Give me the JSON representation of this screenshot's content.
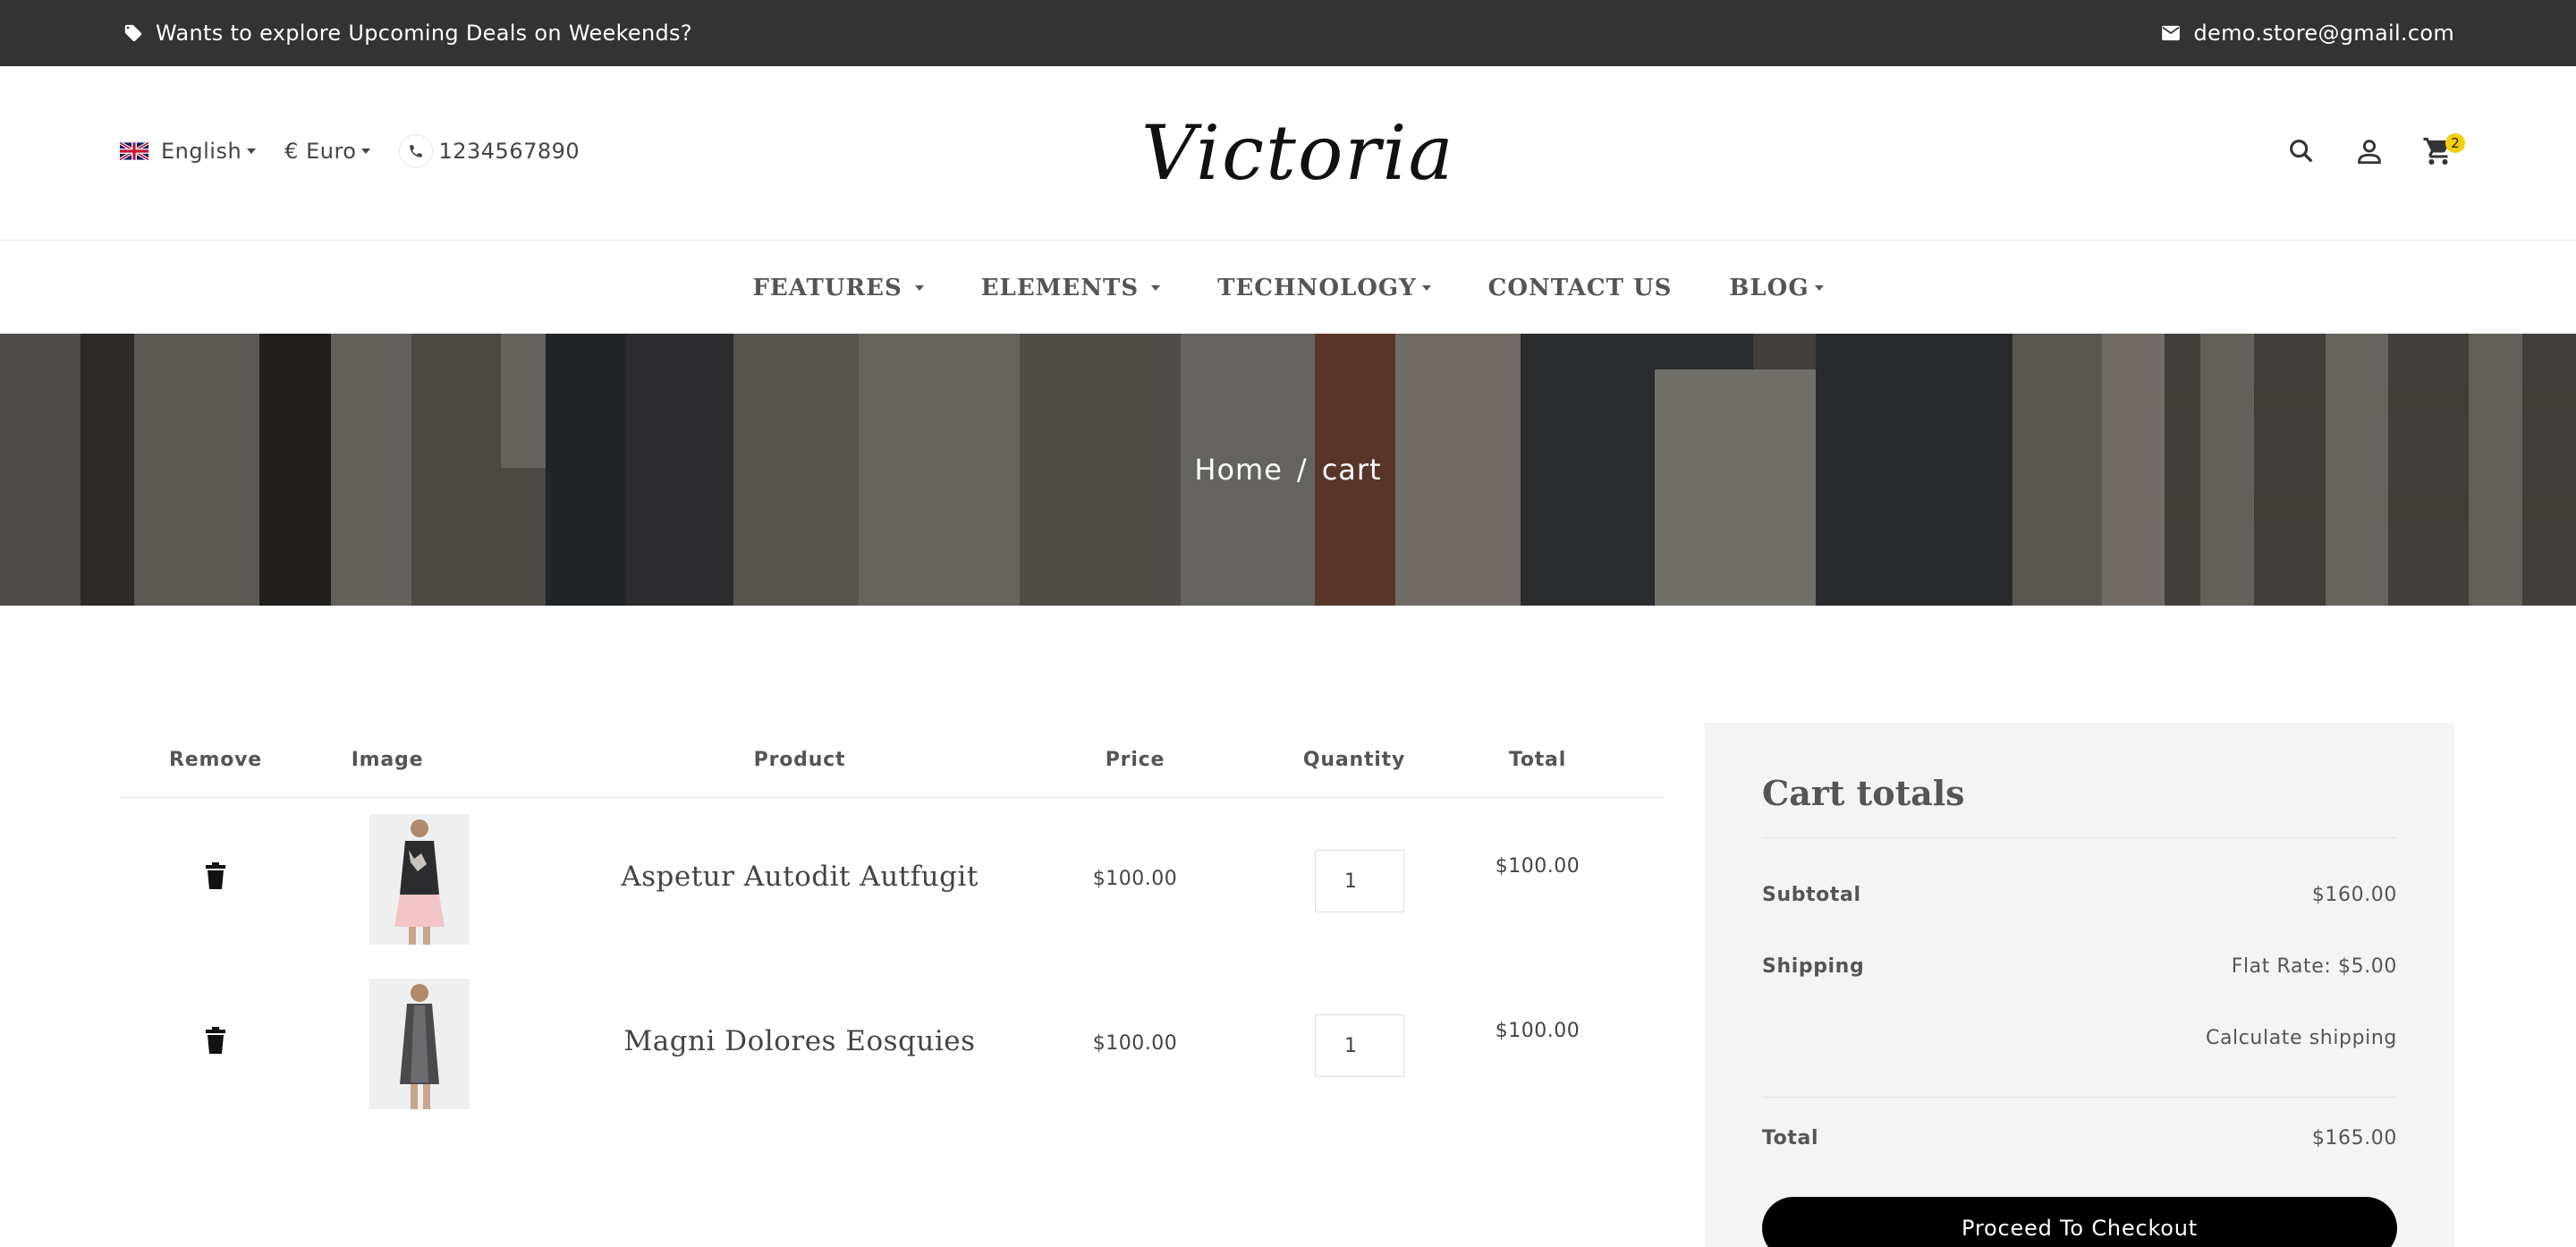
{
  "topbar": {
    "promo_text": "Wants to explore Upcoming Deals on Weekends?",
    "email": "demo.store@gmail.com",
    "icons": {
      "promo": "tag-icon",
      "email": "mail-icon"
    }
  },
  "header": {
    "language": "English",
    "currency": "€ Euro",
    "phone": "1234567890",
    "logo": "Victoria",
    "cart_count": "2",
    "icons": {
      "search": "search-icon",
      "account": "user-icon",
      "cart": "cart-icon",
      "phone": "phone-icon",
      "flag": "uk-flag-icon"
    }
  },
  "nav": {
    "items": [
      "FEATURES",
      "ELEMENTS",
      "TECHNOLOGY",
      "CONTACT US",
      "BLOG"
    ]
  },
  "breadcrumb": {
    "home": "Home",
    "separator": "/",
    "current": "cart"
  },
  "cart_table": {
    "headers": [
      "Remove",
      "Image",
      "Product",
      "Price",
      "Quantity",
      "Total"
    ],
    "rows": [
      {
        "product": "Aspetur Autodit Autfugit",
        "price": "$100.00",
        "quantity": "1",
        "total": "$100.00"
      },
      {
        "product": "Magni Dolores Eosquies",
        "price": "$100.00",
        "quantity": "1",
        "total": "$100.00"
      }
    ]
  },
  "cart_totals": {
    "title": "Cart totals",
    "subtotal_label": "Subtotal",
    "subtotal_value": "$160.00",
    "shipping_label": "Shipping",
    "shipping_value": "Flat Rate: $5.00",
    "calculate_shipping": "Calculate shipping",
    "total_label": "Total",
    "total_value": "$165.00",
    "checkout_label": "Proceed To Checkout"
  },
  "colors": {
    "topbar_bg": "#333333",
    "badge": "#f5cf06",
    "totals_bg": "#f4f4f4",
    "checkout_bg": "#000000"
  }
}
